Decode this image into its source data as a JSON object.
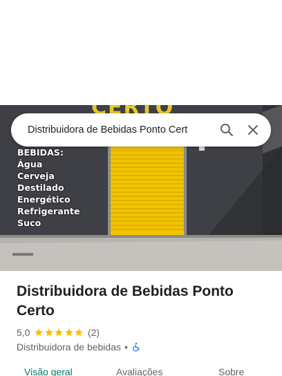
{
  "search": {
    "query": "Distribuidora de Bebidas Ponto Cert"
  },
  "hero": {
    "sign_text": "CERTO",
    "overlay_lines": [
      "BEBIDAS:",
      "Água",
      "Cerveja",
      "Destilado",
      "Energético",
      "Refrigerante",
      "Suco"
    ]
  },
  "place": {
    "name": "Distribuidora de Bebidas Ponto Certo",
    "rating": "5,0",
    "star_count": 5,
    "reviews": "(2)",
    "category": "Distribuidora de bebidas",
    "separator": "•"
  },
  "tabs": [
    {
      "label": "Visão geral",
      "active": true
    },
    {
      "label": "Avaliações",
      "active": false
    },
    {
      "label": "Sobre",
      "active": false
    }
  ],
  "colors": {
    "accent": "#00796b",
    "star": "#fbbc04",
    "shutter": "#f2c300",
    "wall": "#3d3f44",
    "accessibility": "#1a73e8"
  },
  "icons": {
    "search": "search-icon",
    "close": "close-icon",
    "accessibility": "wheelchair-icon"
  }
}
